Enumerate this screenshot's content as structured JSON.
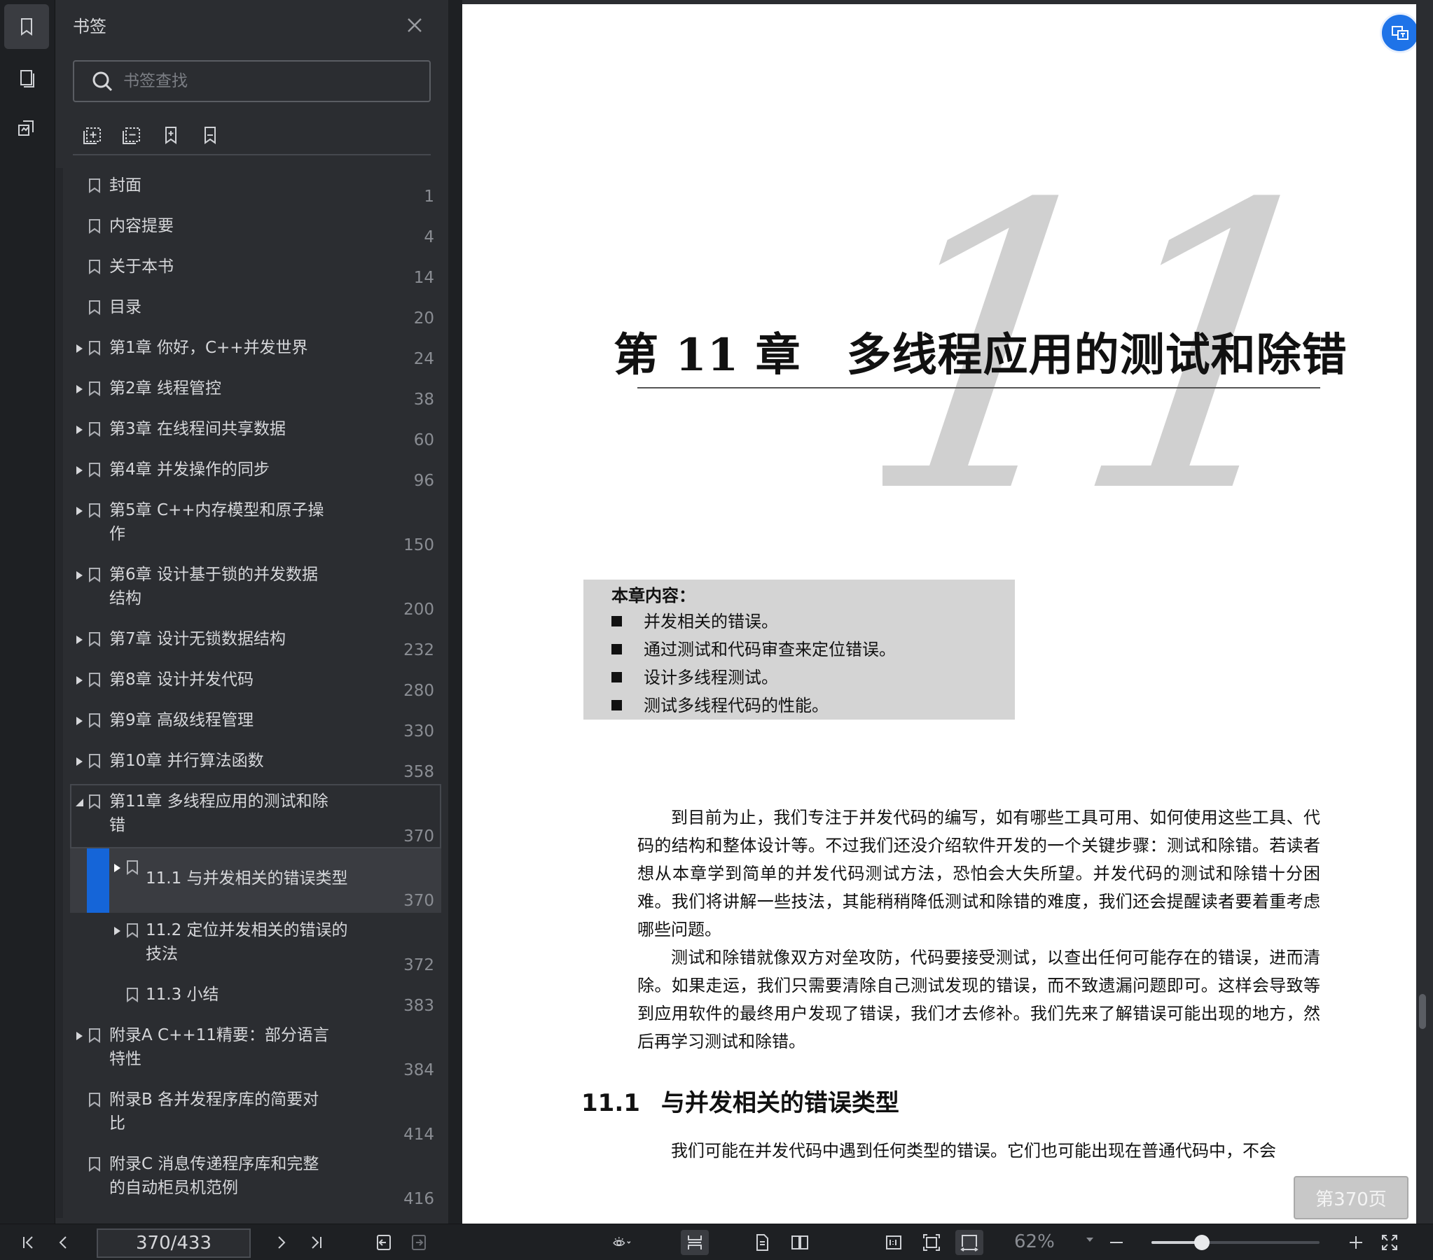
{
  "panel": {
    "title": "书签",
    "search_placeholder": "书签查找"
  },
  "bookmarks": [
    {
      "label": "封面",
      "page": "1",
      "level": 1,
      "expandable": false
    },
    {
      "label": "内容提要",
      "page": "4",
      "level": 1,
      "expandable": false
    },
    {
      "label": "关于本书",
      "page": "14",
      "level": 1,
      "expandable": false
    },
    {
      "label": "目录",
      "page": "20",
      "level": 1,
      "expandable": false
    },
    {
      "label": "第1章 你好，C++并发世界",
      "page": "24",
      "level": 1,
      "expandable": true
    },
    {
      "label": "第2章 线程管控",
      "page": "38",
      "level": 1,
      "expandable": true
    },
    {
      "label": "第3章 在线程间共享数据",
      "page": "60",
      "level": 1,
      "expandable": true
    },
    {
      "label": "第4章 并发操作的同步",
      "page": "96",
      "level": 1,
      "expandable": true
    },
    {
      "label": "第5章 C++内存模型和原子操作",
      "page": "150",
      "level": 1,
      "expandable": true
    },
    {
      "label": "第6章 设计基于锁的并发数据结构",
      "page": "200",
      "level": 1,
      "expandable": true
    },
    {
      "label": "第7章 设计无锁数据结构",
      "page": "232",
      "level": 1,
      "expandable": true
    },
    {
      "label": "第8章 设计并发代码",
      "page": "280",
      "level": 1,
      "expandable": true
    },
    {
      "label": "第9章 高级线程管理",
      "page": "330",
      "level": 1,
      "expandable": true
    },
    {
      "label": "第10章 并行算法函数",
      "page": "358",
      "level": 1,
      "expandable": true
    },
    {
      "label": "第11章 多线程应用的测试和除错",
      "page": "370",
      "level": 1,
      "expandable": true,
      "expanded": true
    },
    {
      "label": "11.1 与并发相关的错误类型",
      "page": "370",
      "level": 2,
      "expandable": true,
      "current": true
    },
    {
      "label": "11.2 定位并发相关的错误的技法",
      "page": "372",
      "level": 2,
      "expandable": true
    },
    {
      "label": "11.3 小结",
      "page": "383",
      "level": 2,
      "expandable": false
    },
    {
      "label": "附录A C++11精要：部分语言特性",
      "page": "384",
      "level": 1,
      "expandable": true
    },
    {
      "label": "附录B 各并发程序库的简要对比",
      "page": "414",
      "level": 1,
      "expandable": false
    },
    {
      "label": "附录C 消息传递程序库和完整的自动柜员机范例",
      "page": "416",
      "level": 1,
      "expandable": false
    }
  ],
  "document": {
    "big_number": "11",
    "chapter_title": "第 11 章　多线程应用的测试和除错",
    "toc_head": "本章内容：",
    "toc_items": [
      "并发相关的错误。",
      "通过测试和代码审查来定位错误。",
      "设计多线程测试。",
      "测试多线程代码的性能。"
    ],
    "para1": "到目前为止，我们专注于并发代码的编写，如有哪些工具可用、如何使用这些工具、代码的结构和整体设计等。不过我们还没介绍软件开发的一个关键步骤：测试和除错。若读者想从本章学到简单的并发代码测试方法，恐怕会大失所望。并发代码的测试和除错十分困难。我们将讲解一些技法，其能稍稍降低测试和除错的难度，我们还会提醒读者要着重考虑哪些问题。",
    "para2": "测试和除错就像双方对垒攻防，代码要接受测试，以查出任何可能存在的错误，进而清除。如果走运，我们只需要清除自己测试发现的错误，而不致遗漏问题即可。这样会导致等到应用软件的最终用户发现了错误，我们才去修补。我们先来了解错误可能出现的地方，然后再学习测试和除错。",
    "section_num": "11.1",
    "section_title": "与并发相关的错误类型",
    "para3": "我们可能在并发代码中遇到任何类型的错误。它们也可能出现在普通代码中，不会",
    "page_badge": "第370页"
  },
  "bottombar": {
    "page_value": "370/433",
    "zoom": "62%",
    "zoom_fraction": 0.3
  },
  "colors": {
    "accent": "#1565d8",
    "panel_bg": "#2b2d31",
    "rail_bg": "#1e2023"
  }
}
